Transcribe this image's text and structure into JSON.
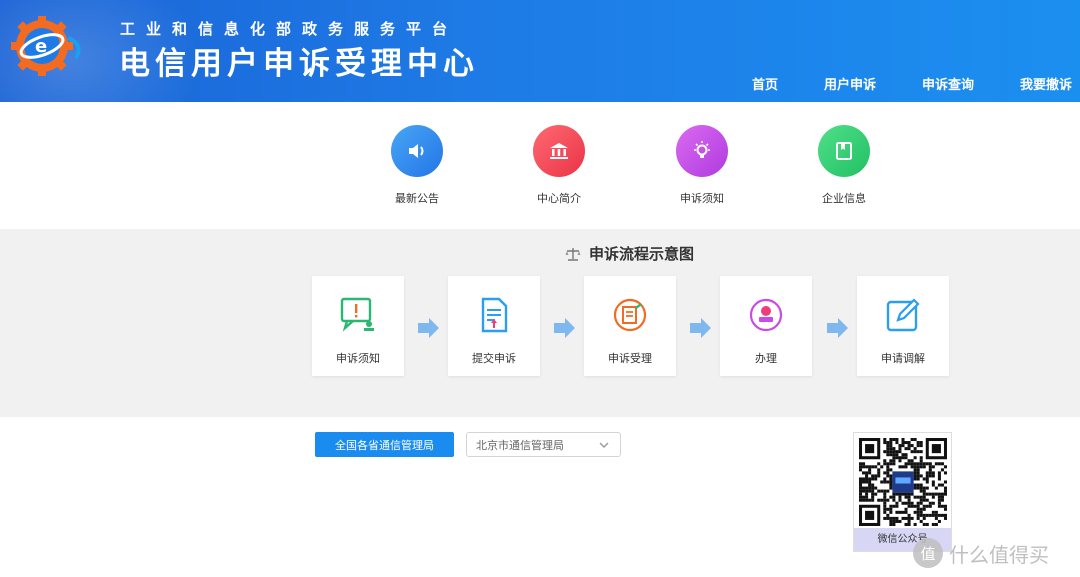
{
  "header": {
    "subtitle": "工业和信息化部政务服务平台",
    "title": "电信用户申诉受理中心",
    "nav": [
      "首页",
      "用户申诉",
      "申诉查询",
      "我要撤诉"
    ]
  },
  "quick_links": [
    {
      "label": "最新公告",
      "icon": "speaker-icon",
      "color": "#2f8ff0"
    },
    {
      "label": "中心简介",
      "icon": "building-icon",
      "color": "#f04a5b"
    },
    {
      "label": "申诉须知",
      "icon": "lightbulb-icon",
      "color": "#c94ae8"
    },
    {
      "label": "企业信息",
      "icon": "book-icon",
      "color": "#2ecf72"
    }
  ],
  "process": {
    "title": "申诉流程示意图",
    "steps": [
      "申诉须知",
      "提交申诉",
      "申诉受理",
      "办理",
      "申请调解"
    ]
  },
  "filters": {
    "national_button": "全国各省通信管理局",
    "province_selected": "北京市通信管理局"
  },
  "qr": {
    "caption": "微信公众号"
  },
  "watermark": {
    "symbol": "值",
    "text": "什么值得买"
  },
  "colors": {
    "header_blue": "#1e7be6",
    "accent_blue": "#1a8cf0",
    "process_bg": "#f1f1f1"
  }
}
